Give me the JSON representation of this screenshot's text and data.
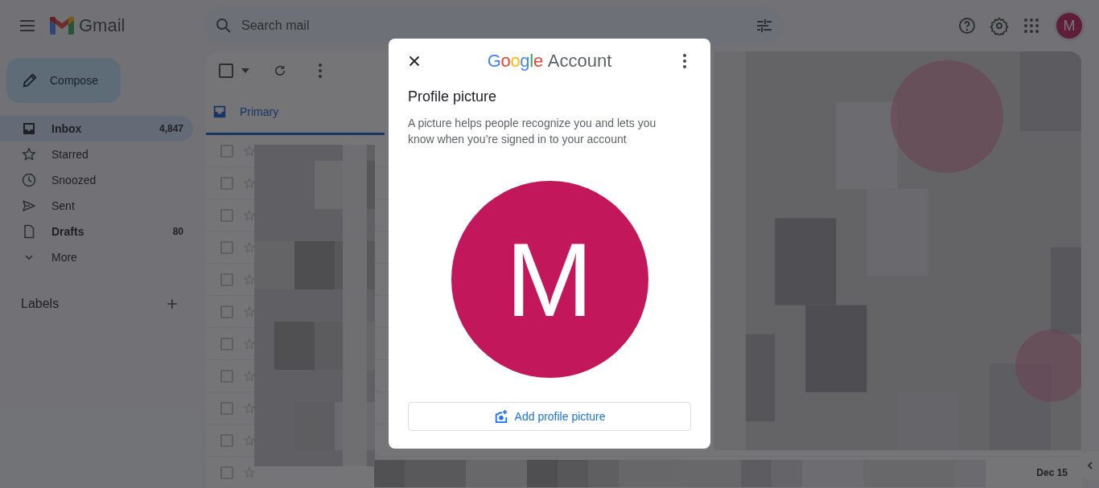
{
  "header": {
    "app_name": "Gmail",
    "search": {
      "placeholder": "Search mail"
    },
    "avatar": {
      "initial": "M"
    }
  },
  "sidebar": {
    "compose": "Compose",
    "items": [
      {
        "label": "Inbox",
        "count": "4,847",
        "selected": true,
        "bold": true
      },
      {
        "label": "Starred",
        "selected": false,
        "bold": false
      },
      {
        "label": "Snoozed",
        "selected": false,
        "bold": false
      },
      {
        "label": "Sent",
        "selected": false,
        "bold": false
      },
      {
        "label": "Drafts",
        "count": "80",
        "selected": false,
        "bold": true
      },
      {
        "label": "More",
        "selected": false,
        "bold": false
      }
    ],
    "labels_heading": "Labels"
  },
  "toolbar": {
    "select_all": {
      "checked": false
    }
  },
  "tabs": [
    {
      "label": "Primary",
      "selected": true
    }
  ],
  "rows": [
    {
      "selected": false,
      "starred": false
    },
    {
      "selected": false,
      "starred": false
    },
    {
      "selected": false,
      "starred": false
    },
    {
      "selected": false,
      "starred": false
    },
    {
      "selected": false,
      "starred": false
    },
    {
      "selected": false,
      "starred": false
    },
    {
      "selected": false,
      "starred": false
    },
    {
      "selected": false,
      "starred": false
    },
    {
      "selected": false,
      "starred": false
    },
    {
      "selected": false,
      "starred": false
    },
    {
      "selected": false,
      "starred": false,
      "date": "Dec 15"
    }
  ],
  "dialog": {
    "brand": "Google",
    "product": "Account",
    "title": "Profile picture",
    "description": "A picture helps people recognize you and lets you know when you’re signed in to your account",
    "avatar": {
      "initial": "M"
    },
    "button": "Add profile picture"
  }
}
